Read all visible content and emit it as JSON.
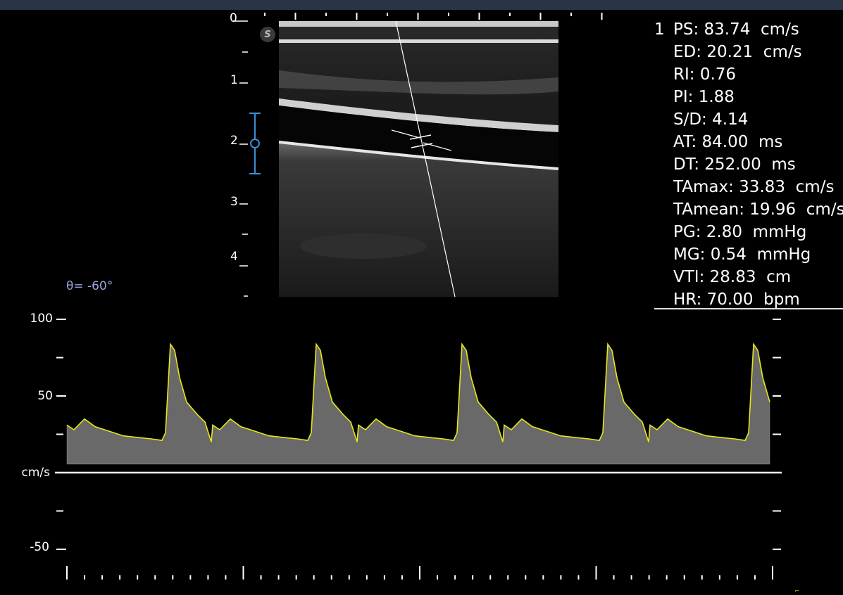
{
  "app": {
    "topbar_color": "#2b3347",
    "accent_trace": "#e6e619",
    "angle_color": "#9da4d8"
  },
  "bmode": {
    "icon": "s-logo-icon",
    "depth_labels": [
      "0",
      "1",
      "2",
      "3",
      "4"
    ],
    "focus_marker_color": "#3a8fd8"
  },
  "measurements": {
    "index": "1",
    "rows": [
      {
        "label": "PS:",
        "value": "83.74",
        "unit": "cm/s"
      },
      {
        "label": "ED:",
        "value": "20.21",
        "unit": "cm/s"
      },
      {
        "label": "RI:",
        "value": "0.76",
        "unit": ""
      },
      {
        "label": "PI:",
        "value": "1.88",
        "unit": ""
      },
      {
        "label": "S/D:",
        "value": "4.14",
        "unit": ""
      },
      {
        "label": "AT:",
        "value": "84.00",
        "unit": "ms"
      },
      {
        "label": "DT:",
        "value": "252.00",
        "unit": "ms"
      },
      {
        "label": "TAmax:",
        "value": "33.83",
        "unit": "cm/s"
      },
      {
        "label": "TAmean:",
        "value": "19.96",
        "unit": "cm/s"
      },
      {
        "label": "PG:",
        "value": "2.80",
        "unit": "mmHg"
      },
      {
        "label": "MG:",
        "value": "0.54",
        "unit": "mmHg"
      },
      {
        "label": "VTI:",
        "value": "28.83",
        "unit": "cm"
      },
      {
        "label": "HR:",
        "value": "70.00",
        "unit": "bpm"
      }
    ]
  },
  "doppler": {
    "angle_text": "θ= -60°",
    "axis_labels": {
      "top": "100",
      "mid": "50",
      "baseline": "cm/s",
      "bottom": "-50"
    },
    "peak_velocity": 83.74,
    "diastolic_velocity": 20.21,
    "beats": 5
  }
}
